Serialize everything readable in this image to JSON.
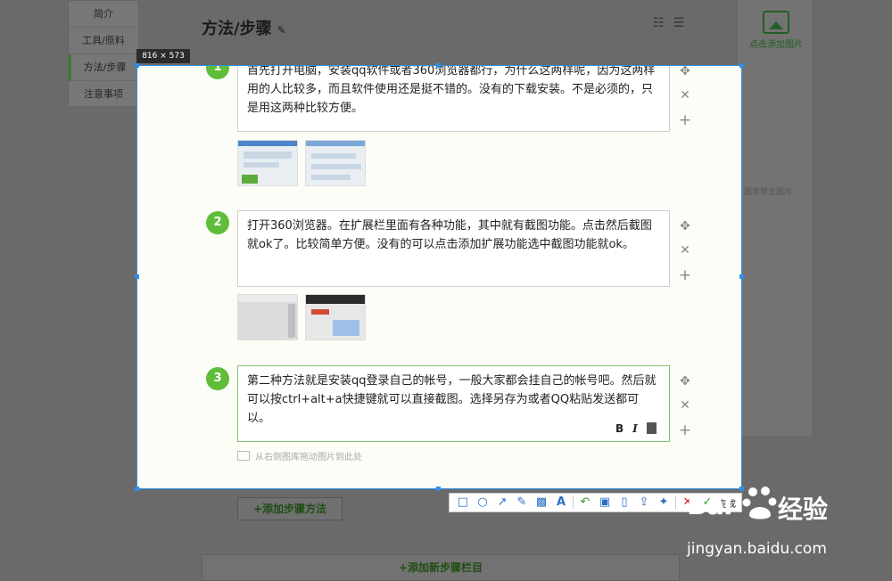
{
  "sidebar": {
    "items": [
      {
        "label": "简介"
      },
      {
        "label": "工具/原料"
      },
      {
        "label": "方法/步骤"
      },
      {
        "label": "注意事项"
      }
    ]
  },
  "header": {
    "title": "方法/步骤"
  },
  "right_panel": {
    "add_image_label": "点击添加图片",
    "empty_tip": "图库暂无图片"
  },
  "capture": {
    "size_label": "816 × 573"
  },
  "steps": [
    {
      "num": "1",
      "text": "首先打开电脑，安装qq软件或者360浏览器都行，为什么这两样呢，因为这两样用的人比较多，而且软件使用还是挺不错的。没有的下载安装。不是必须的，只是用这两种比较方便。"
    },
    {
      "num": "2",
      "text": "打开360浏览器。在扩展栏里面有各种功能，其中就有截图功能。点击然后截图就ok了。比较简单方便。没有的可以点击添加扩展功能选中截图功能就ok。"
    },
    {
      "num": "3",
      "text": "第二种方法就是安装qq登录自己的帐号，一般大家都会挂自己的帐号吧。然后就可以按ctrl+alt+a快捷键就可以直接截图。选择另存为或者QQ粘贴发送都可以。"
    }
  ],
  "editor": {
    "bold": "B",
    "italic": "I"
  },
  "drag_hint": "从右侧图库拖动图片到此处",
  "buttons": {
    "add_step": "+添加步骤方法",
    "add_section": "+添加新步骤栏目"
  },
  "toolbar": {
    "done_label": "完成"
  },
  "watermark": {
    "brand": "Bai",
    "brand_cn": "经验",
    "url": "jingyan.baidu.com"
  },
  "colors": {
    "accent_green": "#5fbd3a",
    "selection_blue": "#2e8fe6",
    "cancel_red": "#d21e1e"
  }
}
